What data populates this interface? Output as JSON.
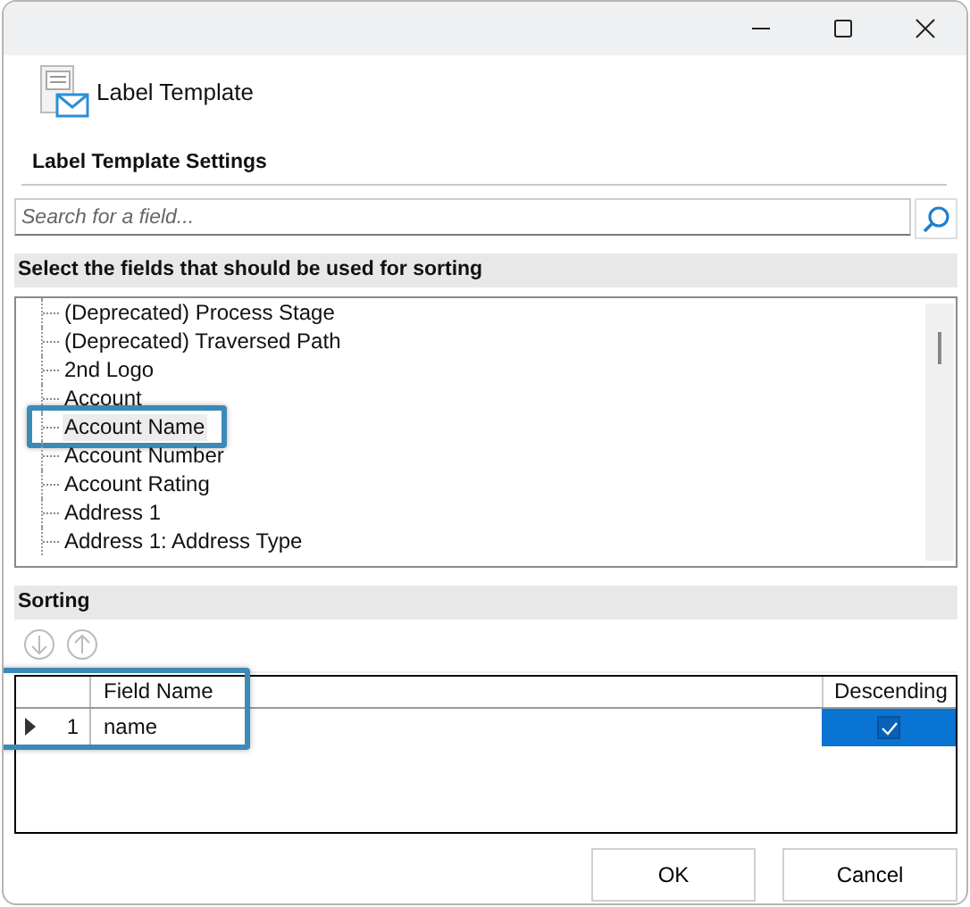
{
  "header": {
    "title": "Label Template"
  },
  "settings": {
    "heading": "Label Template Settings"
  },
  "search": {
    "placeholder": "Search for a field..."
  },
  "fields_section": {
    "heading": "Select the fields that should be used for sorting",
    "items": [
      {
        "label": "(Deprecated) Process Stage",
        "selected": false,
        "highlighted": false
      },
      {
        "label": "(Deprecated) Traversed Path",
        "selected": false,
        "highlighted": false
      },
      {
        "label": "2nd Logo",
        "selected": false,
        "highlighted": false
      },
      {
        "label": "Account",
        "selected": false,
        "highlighted": false
      },
      {
        "label": "Account Name",
        "selected": true,
        "highlighted": true
      },
      {
        "label": "Account Number",
        "selected": false,
        "highlighted": false
      },
      {
        "label": "Account Rating",
        "selected": false,
        "highlighted": false
      },
      {
        "label": "Address 1",
        "selected": false,
        "highlighted": false
      },
      {
        "label": "Address 1: Address Type",
        "selected": false,
        "highlighted": false
      }
    ]
  },
  "sorting": {
    "heading": "Sorting",
    "columns": [
      "Field Name",
      "Descending"
    ],
    "rows": [
      {
        "number": "1",
        "field_name": "name",
        "descending": true,
        "selected": true,
        "highlighted": true
      }
    ]
  },
  "buttons": [
    "OK",
    "Cancel"
  ]
}
